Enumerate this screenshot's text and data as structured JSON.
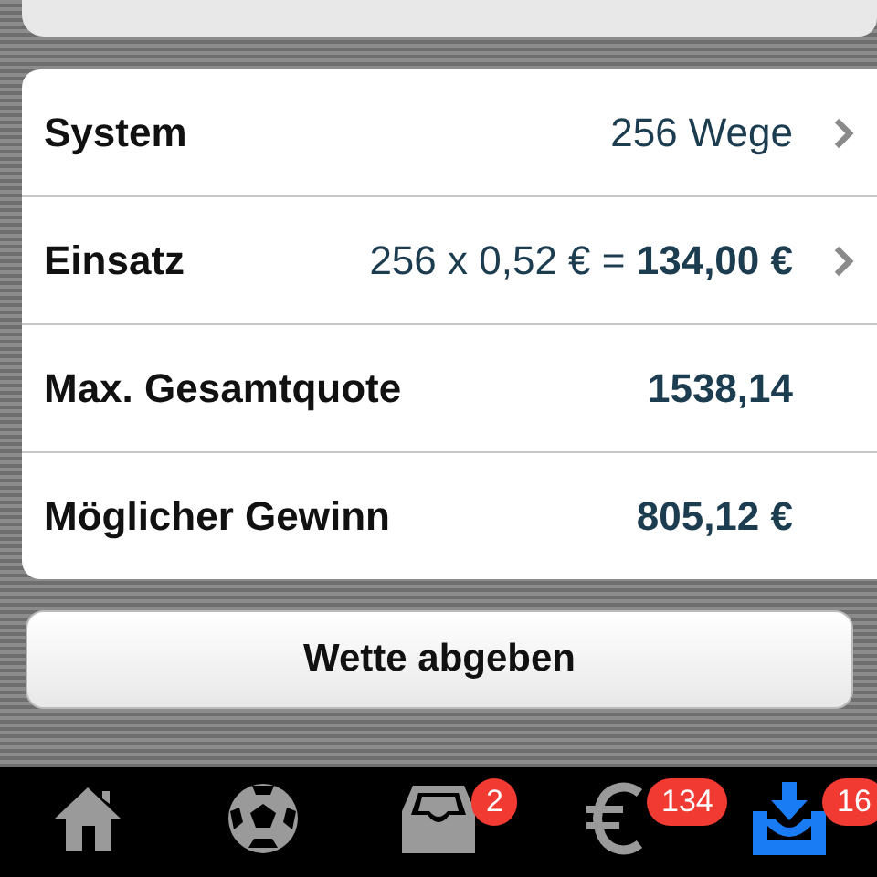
{
  "rows": [
    {
      "label": "System",
      "value": "256 Wege",
      "value_bold": false,
      "chevron": true
    },
    {
      "label": "Einsatz",
      "value": "256 x 0,52 € = **134,00 €**",
      "value_bold": false,
      "chevron": true
    },
    {
      "label": "Max. Gesamtquote",
      "value": "1538,14",
      "value_bold": true,
      "chevron": false
    },
    {
      "label": "Möglicher Gewinn",
      "value": "805,12 €",
      "value_bold": true,
      "chevron": false
    }
  ],
  "submit_button": "Wette abgeben",
  "tab_bar": [
    {
      "kind": "home",
      "selected": false
    },
    {
      "kind": "ball",
      "selected": false
    },
    {
      "kind": "inbox",
      "selected": false,
      "badge": "2"
    },
    {
      "kind": "euro",
      "selected": false,
      "badge": "134"
    },
    {
      "kind": "download",
      "selected": true,
      "badge": "16"
    }
  ]
}
